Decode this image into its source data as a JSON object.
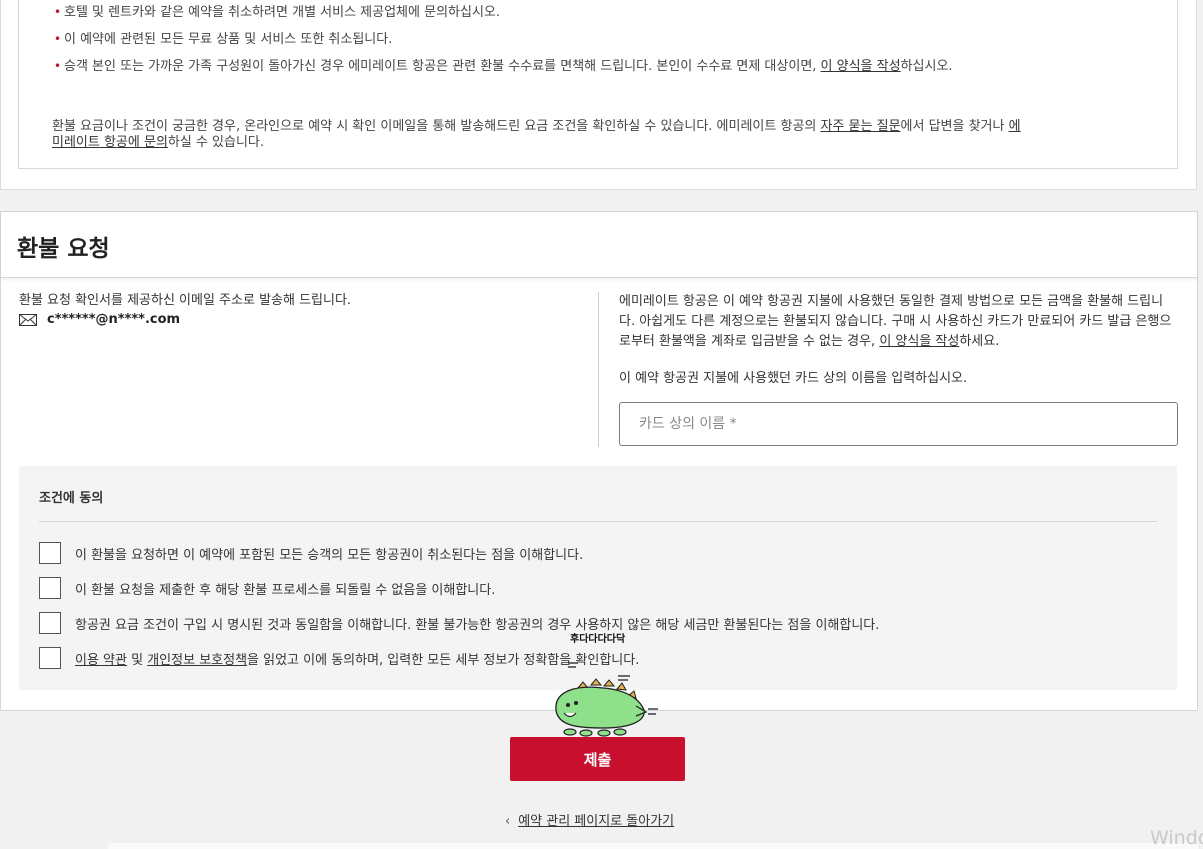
{
  "info": {
    "bullets": [
      {
        "text": "호텔 및 렌트카와 같은 예약을 취소하려면 개별 서비스 제공업체에 문의하십시오."
      },
      {
        "text": "이 예약에 관련된 모든 무료 상품 및 서비스 또한 취소됩니다."
      },
      {
        "text_before": "승객 본인 또는 가까운 가족 구성원이 돌아가신 경우 에미레이트 항공은 관련 환불 수수료를 면책해 드립니다. 본인이 수수료 면제 대상이면, ",
        "link": "이 양식을 작성",
        "text_after": "하십시오."
      }
    ],
    "refund_note": {
      "part1": "환불 요금이나 조건이 궁금한 경우, 온라인으로 예약 시 확인 이메일을 통해 발송해드린 요금 조건을 확인하실 수 있습니다. 에미레이트 항공의 ",
      "faq_link": "자주 묻는 질문",
      "part2": "에서 답변을 찾거나 ",
      "contact_link": "에미레이트 항공에 문의",
      "part3": "하실 수 있습니다."
    }
  },
  "refund_request": {
    "title": "환불 요청",
    "confirmation_message": "환불 요청 확인서를 제공하신 이메일 주소로 발송해 드립니다.",
    "email": "c******@n****.com",
    "payment_info_before": "에미레이트 항공은 이 예약 항공권 지불에 사용했던 동일한 결제 방법으로 모든 금액을 환불해 드립니다. 아쉽게도 다른 계정으로는 환불되지 않습니다. 구매 시 사용하신 카드가 만료되어 카드 발급 은행으로부터 환불액을 계좌로 입금받을 수 없는 경우, ",
    "payment_info_link": "이 양식을 작성",
    "payment_info_after": "하세요.",
    "card_prompt": "이 예약 항공권 지불에 사용했던 카드 상의 이름을 입력하십시오.",
    "card_name_placeholder": "카드 상의 이름 *",
    "card_name_value": ""
  },
  "terms": {
    "title": "조건에 동의",
    "items": [
      {
        "label": "이 환불을 요청하면 이 예약에 포함된 모든 승객의 모든 항공권이 취소된다는 점을 이해합니다.",
        "checked": false
      },
      {
        "label": "이 환불 요청을 제출한 후 해당 환불 프로세스를 되돌릴 수 없음을 이해합니다.",
        "checked": false
      },
      {
        "label": "항공권 요금 조건이 구입 시 명시된 것과 동일함을 이해합니다. 환불 불가능한 항공권의 경우 사용하지 않은 해당 세금만 환불된다는 점을 이해합니다.",
        "checked": false
      },
      {
        "terms_link": "이용 약관",
        "and": " 및 ",
        "privacy_link": "개인정보 보호정책",
        "rest": "을 읽었고 이에 동의하며, 입력한 모든 세부 정보가 정확함을 확인합니다.",
        "checked": false
      }
    ]
  },
  "actions": {
    "submit_label": "제출",
    "back_label": "예약 관리 페이지로 돌아가기"
  },
  "sticker": {
    "text": "후다다다다닥"
  },
  "windows_watermark": "Windo",
  "colors": {
    "accent": "#c8102e",
    "terms_bg": "#f4f4f4",
    "sticker_green": "#8ee08a"
  },
  "icons": [
    "mail-icon",
    "chevron-left-icon",
    "bullet-dot-icon"
  ]
}
